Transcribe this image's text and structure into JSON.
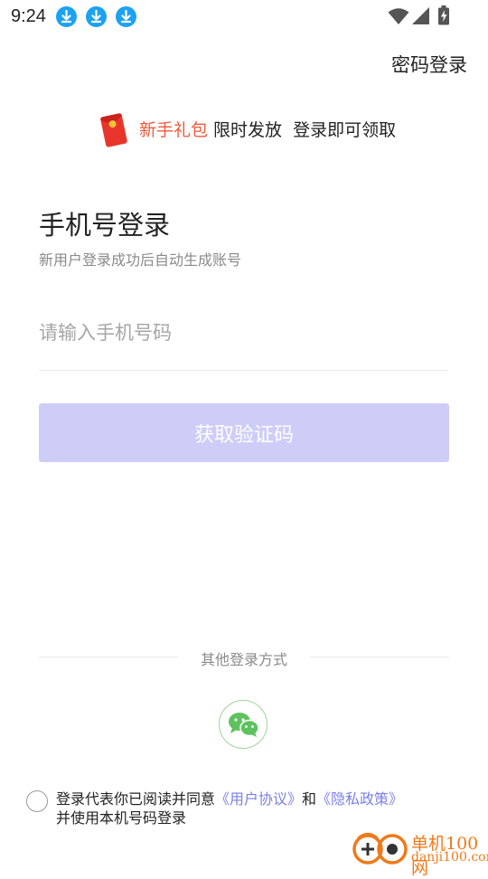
{
  "status_bar": {
    "time": "9:24",
    "notification_icons": [
      "download-icon",
      "download-icon",
      "download-icon"
    ],
    "right_icons": [
      "wifi-icon",
      "signal-icon",
      "battery-charging-icon"
    ]
  },
  "header": {
    "password_login": "密码登录"
  },
  "promo": {
    "icon": "red-envelope-icon",
    "highlight": "新手礼包",
    "text": " 限时发放  登录即可领取",
    "highlight_color": "#ee5a3c"
  },
  "main": {
    "title": "手机号登录",
    "subtitle": "新用户登录成功后自动生成账号",
    "phone_input": {
      "placeholder": "请输入手机号码",
      "value": ""
    },
    "get_code_button": "获取验证码",
    "button_color": "#cdcdf8"
  },
  "other_login": {
    "label": "其他登录方式",
    "methods": [
      "wechat-icon"
    ],
    "wechat_color": "#5ec25e"
  },
  "agreement": {
    "prefix": "登录代表你已阅读并同意",
    "user_agreement": "《用户协议》",
    "and": "和",
    "privacy_policy": "《隐私政策》",
    "suffix": "并使用本机号码登录",
    "link_color": "#7b7fe6"
  },
  "watermark": {
    "name": "单机100网",
    "url": "danji100.com"
  }
}
